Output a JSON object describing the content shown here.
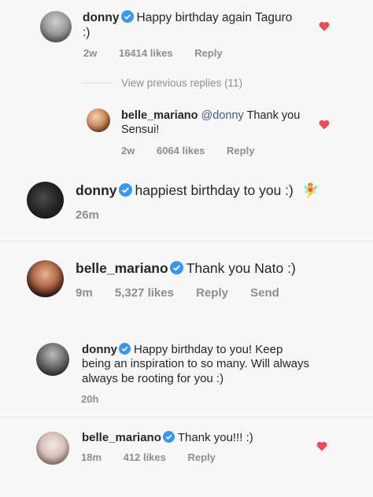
{
  "comments": [
    {
      "username": "donny",
      "text": "Happy birthday again Taguro :)",
      "time": "2w",
      "likes": "16414 likes",
      "reply": "Reply",
      "liked": true
    },
    {
      "view_previous": "View previous replies (11)"
    },
    {
      "username": "belle_mariano",
      "mention": "@donny",
      "text": "Thank you Sensui!",
      "time": "2w",
      "likes": "6064 likes",
      "reply": "Reply",
      "liked": true
    },
    {
      "username": "donny",
      "text": "happiest birthday to you :)",
      "emoji": "🧚",
      "time": "26m"
    },
    {
      "username": "belle_mariano",
      "text": "Thank you Nato :)",
      "time": "9m",
      "likes": "5,327 likes",
      "reply": "Reply",
      "send": "Send"
    },
    {
      "username": "donny",
      "text": "Happy birthday to you! Keep being an inspiration to so many. Will always always be rooting for you :)",
      "time": "20h"
    },
    {
      "username": "belle_mariano",
      "text": "Thank you!!! :)",
      "time": "18m",
      "likes": "412 likes",
      "reply": "Reply",
      "liked": true
    }
  ],
  "icons": {
    "verified": "verified-badge-icon",
    "heart": "heart-icon"
  },
  "colors": {
    "verified": "#3897f0",
    "heart": "#ed4956",
    "meta": "#8e8e8e",
    "mention": "#3f5b86"
  }
}
